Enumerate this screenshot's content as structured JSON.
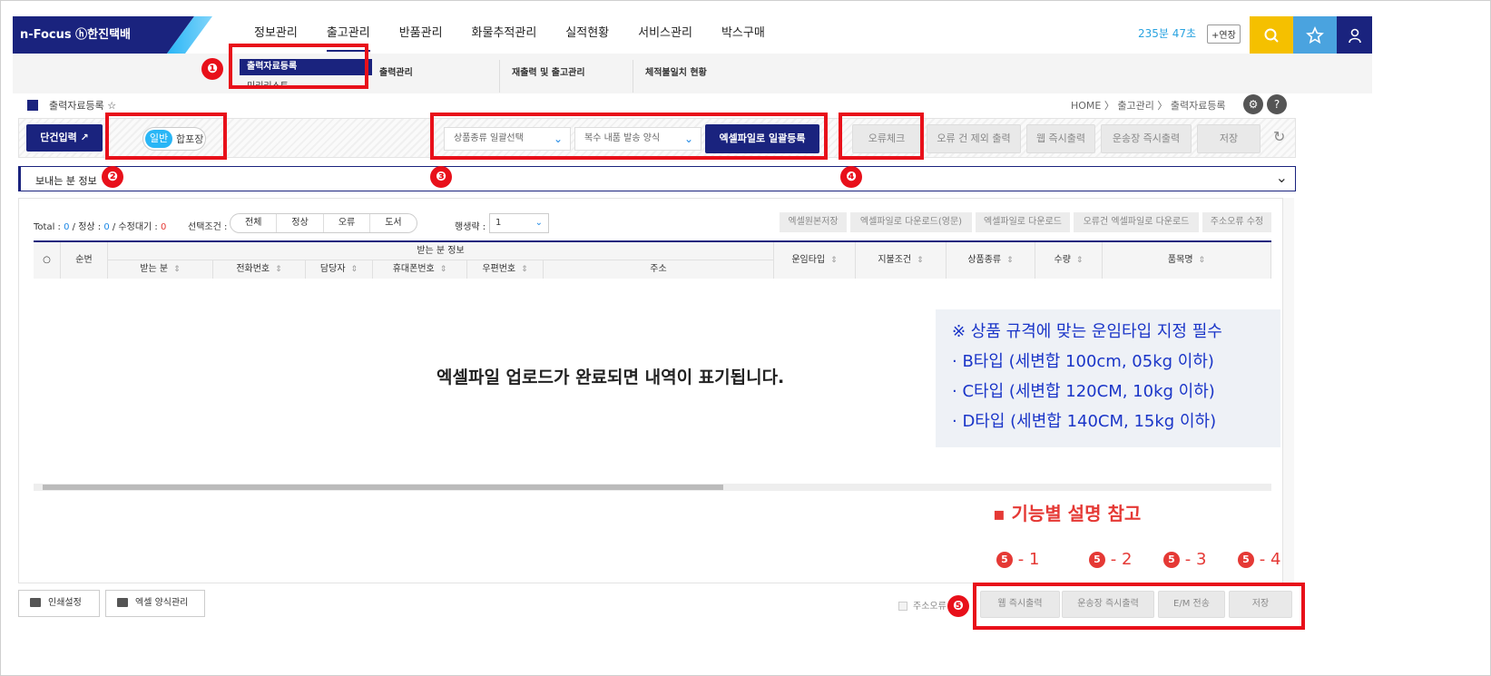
{
  "brand": "n-Focus ⓗ한진택배",
  "nav": [
    "정보관리",
    "출고관리",
    "반품관리",
    "화물추적관리",
    "실적현황",
    "서비스관리",
    "박스구매"
  ],
  "timer": "235분 47초",
  "extend_label": "+연장",
  "submenu": {
    "active": "출력자료등록",
    "next": "미리리스트",
    "items": [
      "출력관리",
      "재출력 및 출고관리",
      "체적불일치 현황"
    ]
  },
  "page_title": "출력자료등록",
  "breadcrumb": "HOME 〉 출고관리 〉 출력자료등록",
  "toolbar": {
    "single_input": "단건입력",
    "toggle_on": "일반",
    "toggle_off": "합포장",
    "product_select": "상품종류 일괄선택",
    "multi_select": "복수 내품 발송 양식",
    "excel_bulk": "엑셀파일로 일괄등록",
    "error_check": "오류체크",
    "print_excl_error": "오류 건 제외 출력",
    "web_print": "웹 즉시출력",
    "waybill_print": "운송장 즉시출력",
    "save": "저장"
  },
  "sender_label": "보내는 분 정보",
  "stats": {
    "total_label": "Total : ",
    "total": "0",
    "normal_label": " / 정상 : ",
    "normal": "0",
    "pending_label": " / 수정대기 : ",
    "pending": "0"
  },
  "filter_label": "선택조건 :",
  "filters": [
    "전체",
    "정상",
    "오류",
    "도서"
  ],
  "rows_label": "행생략 :",
  "rows_value": "1",
  "grid_buttons": [
    "엑셀원본저장",
    "엑셀파일로 다운로드(영문)",
    "엑셀파일로 다운로드",
    "오류건 엑셀파일로 다운로드",
    "주소오류 수정"
  ],
  "table": {
    "group_header": "받는 분 정보",
    "col_no": "순번",
    "sub_cols": [
      "받는 분",
      "전화번호",
      "담당자",
      "휴대폰번호",
      "우편번호",
      "주소"
    ],
    "cols": [
      "운임타입",
      "지불조건",
      "상품종류",
      "수량",
      "품목명"
    ]
  },
  "empty_message": "엑셀파일 업로드가 완료되면 내역이 표기됩니다.",
  "note": {
    "title": "※ 상품 규격에 맞는 운임타입 지정 필수",
    "lines": [
      "· B타입 (세변합 100cm, 05kg 이하)",
      "· C타입 (세변합 120CM, 10kg 이하)",
      "· D타입 (세변합 140CM, 15kg 이하)"
    ]
  },
  "func_title": "▪ 기능별 설명 참고",
  "func_labels": [
    "- 1",
    "- 2",
    "- 3",
    "- 4"
  ],
  "bottom": {
    "print_settings": "인쇄설정",
    "excel_format": "엑셀 양식관리",
    "address_check": "주소오류",
    "web_print": "웹 즉시출력",
    "waybill_print": "운송장 즉시출력",
    "em_send": "E/M 전송",
    "save": "저장"
  },
  "markers": [
    "❶",
    "❷",
    "❸",
    "❹",
    "❺"
  ],
  "colors": {
    "navy": "#1a237e",
    "accent_blue": "#29b6f6",
    "highlight_red": "#e8101a",
    "note_blue": "#1a35c8"
  }
}
